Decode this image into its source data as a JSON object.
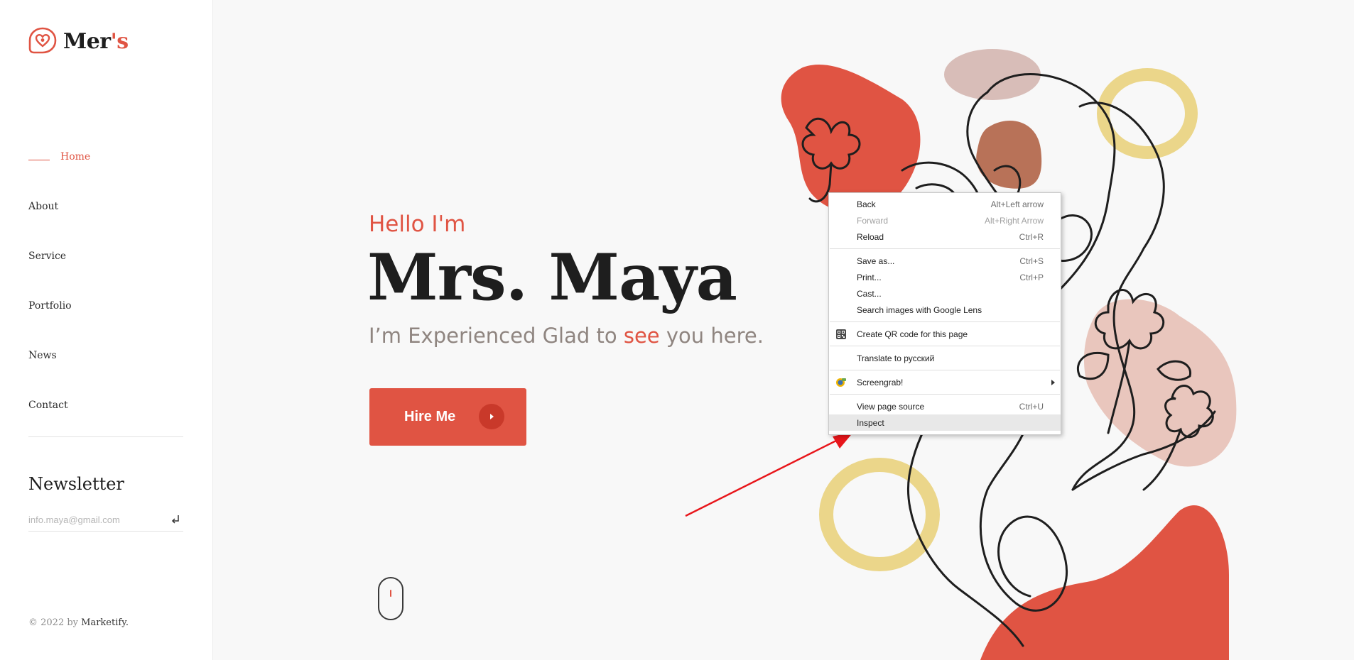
{
  "brand": {
    "logo_main": "Mer",
    "logo_accent": "'s"
  },
  "nav": {
    "items": [
      {
        "label": "Home",
        "active": true
      },
      {
        "label": "About"
      },
      {
        "label": "Service"
      },
      {
        "label": "Portfolio"
      },
      {
        "label": "News"
      },
      {
        "label": "Contact"
      }
    ]
  },
  "newsletter": {
    "title": "Newsletter",
    "placeholder": "info.maya@gmail.com",
    "submit_icon": "enter-arrow-icon"
  },
  "footer": {
    "copyright_prefix": "© 2022 by ",
    "company": "Marketify."
  },
  "hero": {
    "greeting": "Hello I'm",
    "name": "Mrs. Maya",
    "tagline_before": "I’m Experienced Glad to ",
    "tagline_highlight": "see",
    "tagline_after": " you here.",
    "cta_label": "Hire Me"
  },
  "context_menu": {
    "groups": [
      [
        {
          "label": "Back",
          "shortcut": "Alt+Left arrow"
        },
        {
          "label": "Forward",
          "shortcut": "Alt+Right Arrow",
          "disabled": true
        },
        {
          "label": "Reload",
          "shortcut": "Ctrl+R"
        }
      ],
      [
        {
          "label": "Save as...",
          "shortcut": "Ctrl+S"
        },
        {
          "label": "Print...",
          "shortcut": "Ctrl+P"
        },
        {
          "label": "Cast..."
        },
        {
          "label": "Search images with Google Lens"
        }
      ],
      [
        {
          "label": "Create QR code for this page",
          "icon": "qr-code-icon"
        }
      ],
      [
        {
          "label": "Translate to русский"
        }
      ],
      [
        {
          "label": "Screengrab!",
          "icon": "screengrab-icon",
          "submenu": true
        }
      ],
      [
        {
          "label": "View page source",
          "shortcut": "Ctrl+U"
        },
        {
          "label": "Inspect",
          "highlighted": true
        }
      ]
    ]
  },
  "colors": {
    "accent": "#e05443",
    "text_dark": "#1e1e1e",
    "tagline_gray": "#8f8580",
    "blob_pink": "#e9c6bd",
    "blob_yellow": "#ebd68a",
    "blob_brown": "#b87258",
    "blob_mauve": "#d8bdb8"
  }
}
